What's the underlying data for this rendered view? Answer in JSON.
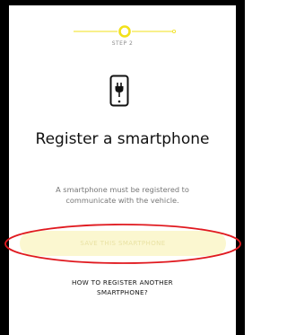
{
  "stepper": {
    "label": "STEP 2",
    "accent_color": "#f2e11a",
    "current_step": 2,
    "total_steps": 3
  },
  "icon": {
    "name": "smartphone-charging-icon"
  },
  "title": "Register a smartphone",
  "description": "A smartphone must be registered to communicate with the vehicle.",
  "primary_button": {
    "label": "SAVE THIS SMARTPHONE",
    "state": "disabled"
  },
  "secondary_link": {
    "label": "HOW TO REGISTER ANOTHER SMARTPHONE?"
  },
  "annotation": {
    "color": "#e0191f"
  }
}
